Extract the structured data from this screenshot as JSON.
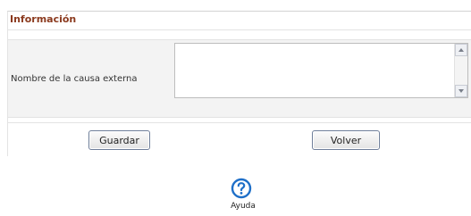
{
  "section": {
    "title": "Información"
  },
  "form": {
    "field_label": "Nombre de la causa externa",
    "field_value": ""
  },
  "buttons": {
    "save_label": "Guardar",
    "back_label": "Volver"
  },
  "help": {
    "label": "Ayuda",
    "icon": "help-question-icon"
  },
  "colors": {
    "title": "#8b3a1e",
    "help_icon": "#1e6fc8"
  }
}
